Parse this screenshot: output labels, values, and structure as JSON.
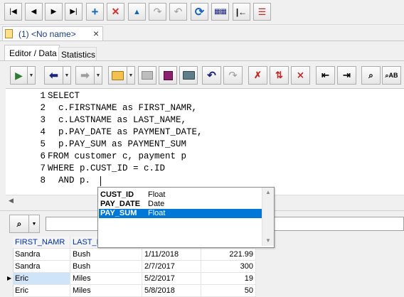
{
  "nav_toolbar": {
    "icons": [
      "first-record-icon",
      "prior-record-icon",
      "next-record-icon",
      "last-record-icon",
      "insert-record-icon",
      "delete-record-icon",
      "post-edit-icon",
      "cancel-edit-icon",
      "undo-edit-icon",
      "refresh-icon",
      "grid-columns-icon",
      "pin-icon",
      "filter-icon"
    ]
  },
  "doc_tab": {
    "title": "(1) <No name>",
    "close": "×"
  },
  "editor_tabs": [
    {
      "label": "Editor / Data"
    },
    {
      "label": "Statistics"
    }
  ],
  "editor": {
    "line_numbers": [
      "1",
      "2",
      "3",
      "4",
      "5",
      "6",
      "7",
      "8"
    ],
    "lines": [
      "SELECT",
      "  c.FIRSTNAME as FIRST_NAMR,",
      "  c.LASTNAME as LAST_NAME,",
      "  p.PAY_DATE as PAYMENT_DATE,",
      "  p.PAY_SUM as PAYMENT_SUM",
      "FROM customer c, payment p",
      "WHERE p.CUST_ID = c.ID",
      "  AND p."
    ]
  },
  "autocomplete": {
    "items": [
      {
        "name": "CUST_ID",
        "type": "Float",
        "selected": false
      },
      {
        "name": "PAY_DATE",
        "type": "Date",
        "selected": false
      },
      {
        "name": "PAY_SUM",
        "type": "Float",
        "selected": true
      }
    ]
  },
  "grid": {
    "headers": [
      "FIRST_NAMR",
      "LAST_N"
    ],
    "rows": [
      {
        "first": "Sandra",
        "last": "Bush",
        "date": "1/11/2018",
        "sum": "221.99"
      },
      {
        "first": "Sandra",
        "last": "Bush",
        "date": "2/7/2017",
        "sum": "300"
      },
      {
        "first": "Eric",
        "last": "Miles",
        "date": "5/2/2017",
        "sum": "19"
      },
      {
        "first": "Eric",
        "last": "Miles",
        "date": "5/8/2018",
        "sum": "50"
      }
    ]
  },
  "colors": {
    "selection": "#0078d7",
    "grid_header_text": "#0030b0"
  }
}
